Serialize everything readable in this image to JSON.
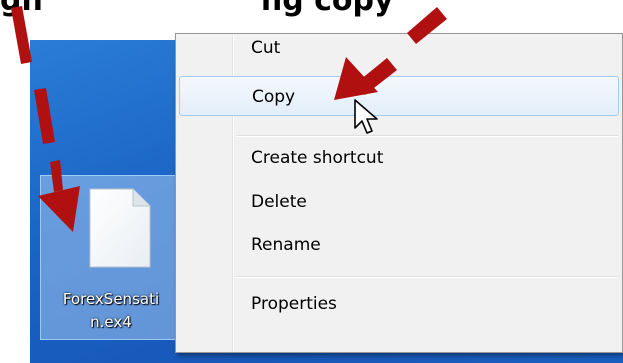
{
  "heading": {
    "left_text": "gh",
    "right_text": "ng copy"
  },
  "file": {
    "name_line1": "ForexSensati",
    "name_line2": "n.ex4",
    "icon": "blank-document-icon",
    "selected": true
  },
  "context_menu": {
    "items": [
      {
        "label": "Cut"
      },
      {
        "label": "Copy",
        "highlighted": true
      },
      {
        "label": "Create shortcut"
      },
      {
        "label": "Delete"
      },
      {
        "label": "Rename"
      },
      {
        "label": "Properties"
      }
    ]
  },
  "colors": {
    "annotation_arrow": "#b01010",
    "desktop_background": "#1a63c4",
    "menu_background": "#f1f1f1",
    "menu_highlight_border": "#a8cbf0"
  }
}
